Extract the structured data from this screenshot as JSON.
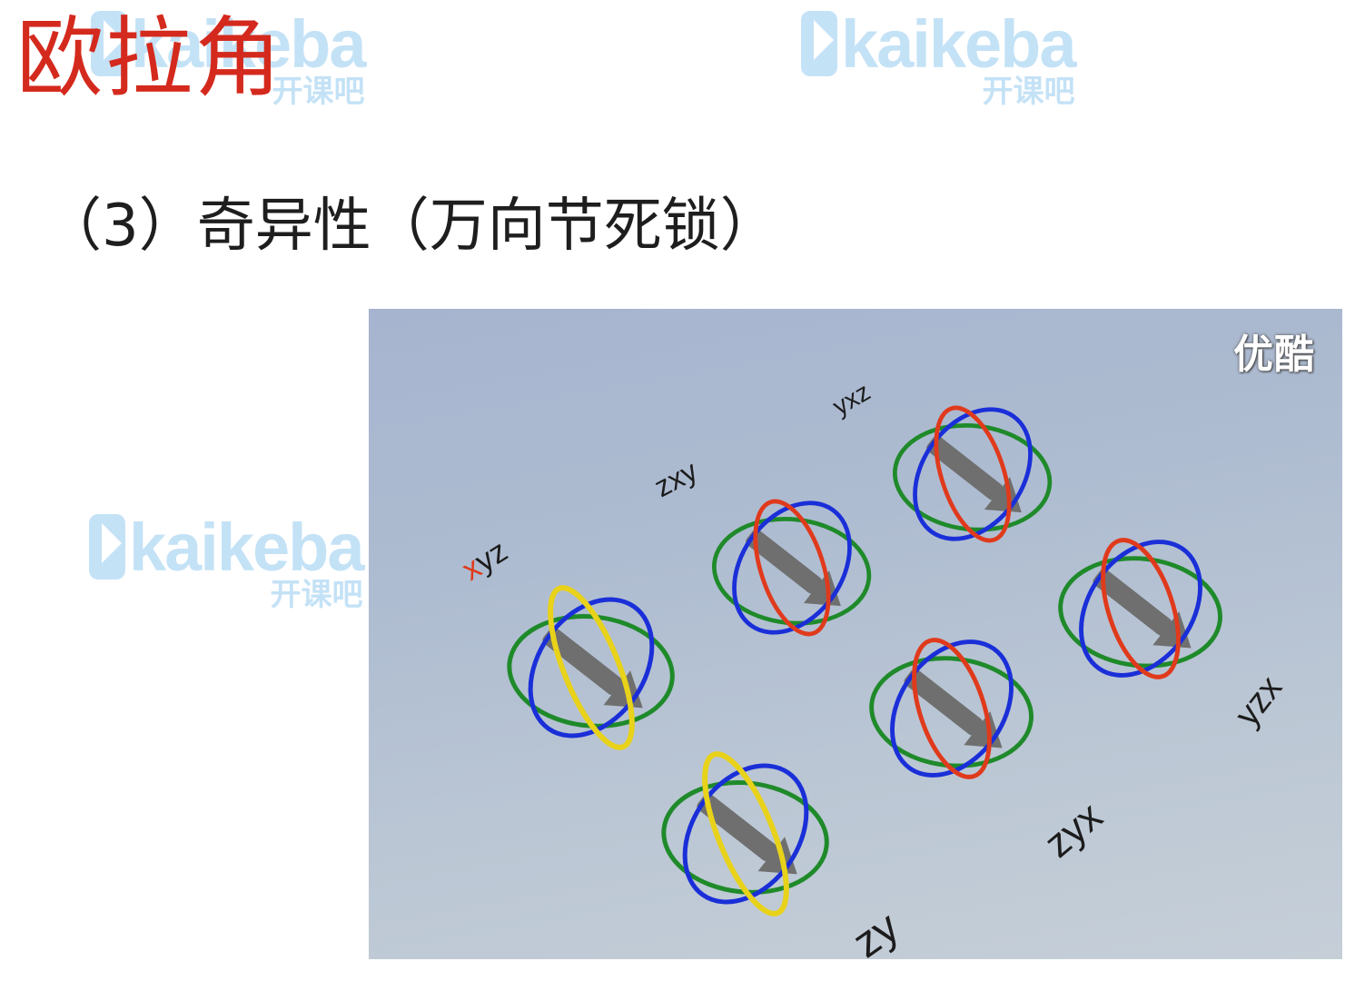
{
  "slide": {
    "title": "欧拉角",
    "subtitle": "（3）奇异性（万向节死锁）",
    "title_color": "#d42a1e"
  },
  "watermarks": [
    {
      "brand": "kaikeba",
      "sub": "开课吧"
    },
    {
      "brand": "kaikeba",
      "sub": "开课吧"
    },
    {
      "brand": "kaikeba",
      "sub": "开课吧"
    }
  ],
  "video": {
    "player_logo": "优酷",
    "order_labels": [
      "xyz",
      "zxy",
      "yxz",
      "yzx",
      "zyx",
      "zy"
    ],
    "ring_colors": {
      "x": "#e03a1c",
      "y": "#1a2fd8",
      "z": "#1f8a2a",
      "locked": "#e8d21a",
      "arrow": "#6f6f6f"
    }
  }
}
